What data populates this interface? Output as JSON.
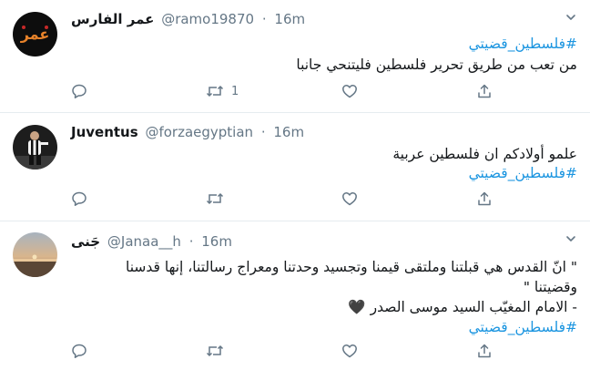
{
  "tweets": [
    {
      "name": "عمر الفارس",
      "handle": "@ramo19870",
      "dot": "·",
      "time": "16m",
      "avatar_text": "عمر",
      "lines": [
        "#فلسطين_قضيتي",
        "من تعب من طريق تحرير فلسطين فليتنحي جانبا"
      ],
      "retweets": "1"
    },
    {
      "name": "Juventus",
      "handle": "@forzaegyptian",
      "dot": "·",
      "time": "16m",
      "lines": [
        "علمو أولادكم ان فلسطين عربية",
        "#فلسطين_قضيتي"
      ],
      "retweets": ""
    },
    {
      "name": "جَنى",
      "handle": "@Janaa__h",
      "dot": "·",
      "time": "16m",
      "lines": [
        "\" انّ القدس هي قبلتنا وملتقى قيمنا وتجسيد وحدتنا ومعراج رسالتنا، إنها قدسنا",
        "وقضيتنا \"",
        "- الامام المغيّب السيد موسى الصدر",
        "#فلسطين_قضيتي"
      ],
      "heart_emoji": "🖤",
      "retweets": ""
    }
  ],
  "colors": {
    "link": "#1b95e0",
    "muted": "#657786",
    "divider": "#e6ecf0"
  },
  "icons": [
    "reply-icon",
    "retweet-icon",
    "like-icon",
    "share-icon",
    "chevron-down-icon"
  ]
}
